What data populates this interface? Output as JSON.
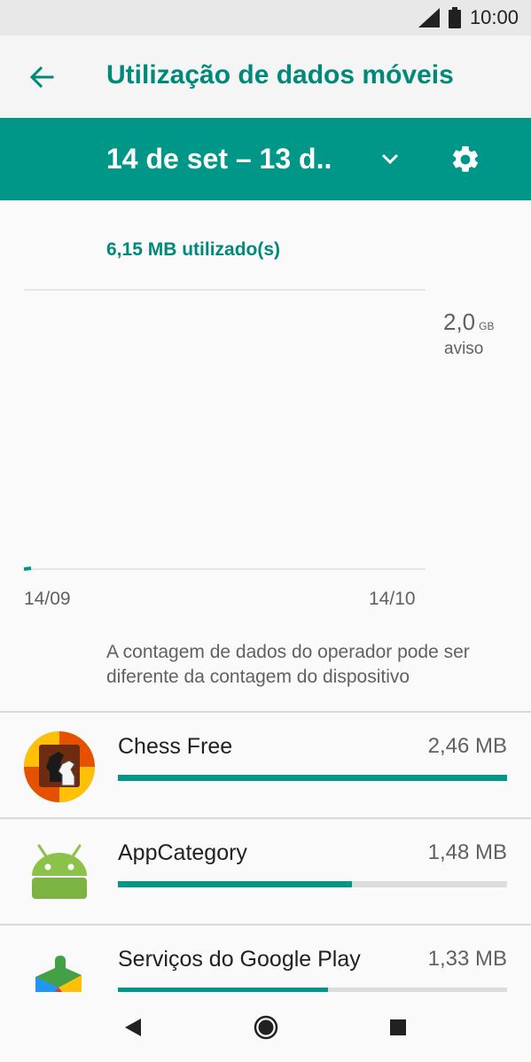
{
  "status_bar": {
    "time": "10:00",
    "icons": [
      "signal-icon",
      "battery-icon"
    ]
  },
  "app_bar": {
    "back_icon": "back-arrow-icon",
    "title": "Utilização de dados móveis"
  },
  "cycle_bar": {
    "label": "14 de set – 13 d..",
    "dropdown_icon": "chevron-down-icon",
    "settings_icon": "gear-icon"
  },
  "usage": {
    "summary": "6,15 MB utilizado(s)",
    "warning_value": "2,0",
    "warning_unit": "GB",
    "warning_label": "aviso",
    "axis_start": "14/09",
    "axis_end": "14/10",
    "note": "A contagem de dados do operador pode ser diferente da contagem do dispositivo"
  },
  "apps": [
    {
      "name": "Chess Free",
      "size": "2,46 MB",
      "fraction": 1.0,
      "icon": "chess-icon"
    },
    {
      "name": "AppCategory",
      "size": "1,48 MB",
      "fraction": 0.602,
      "icon": "android-icon"
    },
    {
      "name": "Serviços do Google Play",
      "size": "1,33 MB",
      "fraction": 0.541,
      "icon": "google-play-services-icon"
    }
  ],
  "colors": {
    "accent": "#009688",
    "accent_dark": "#00897b",
    "track": "#dcdcdc"
  },
  "nav_bar": {
    "icons": [
      "back-triangle-icon",
      "home-circle-icon",
      "recents-square-icon"
    ]
  }
}
